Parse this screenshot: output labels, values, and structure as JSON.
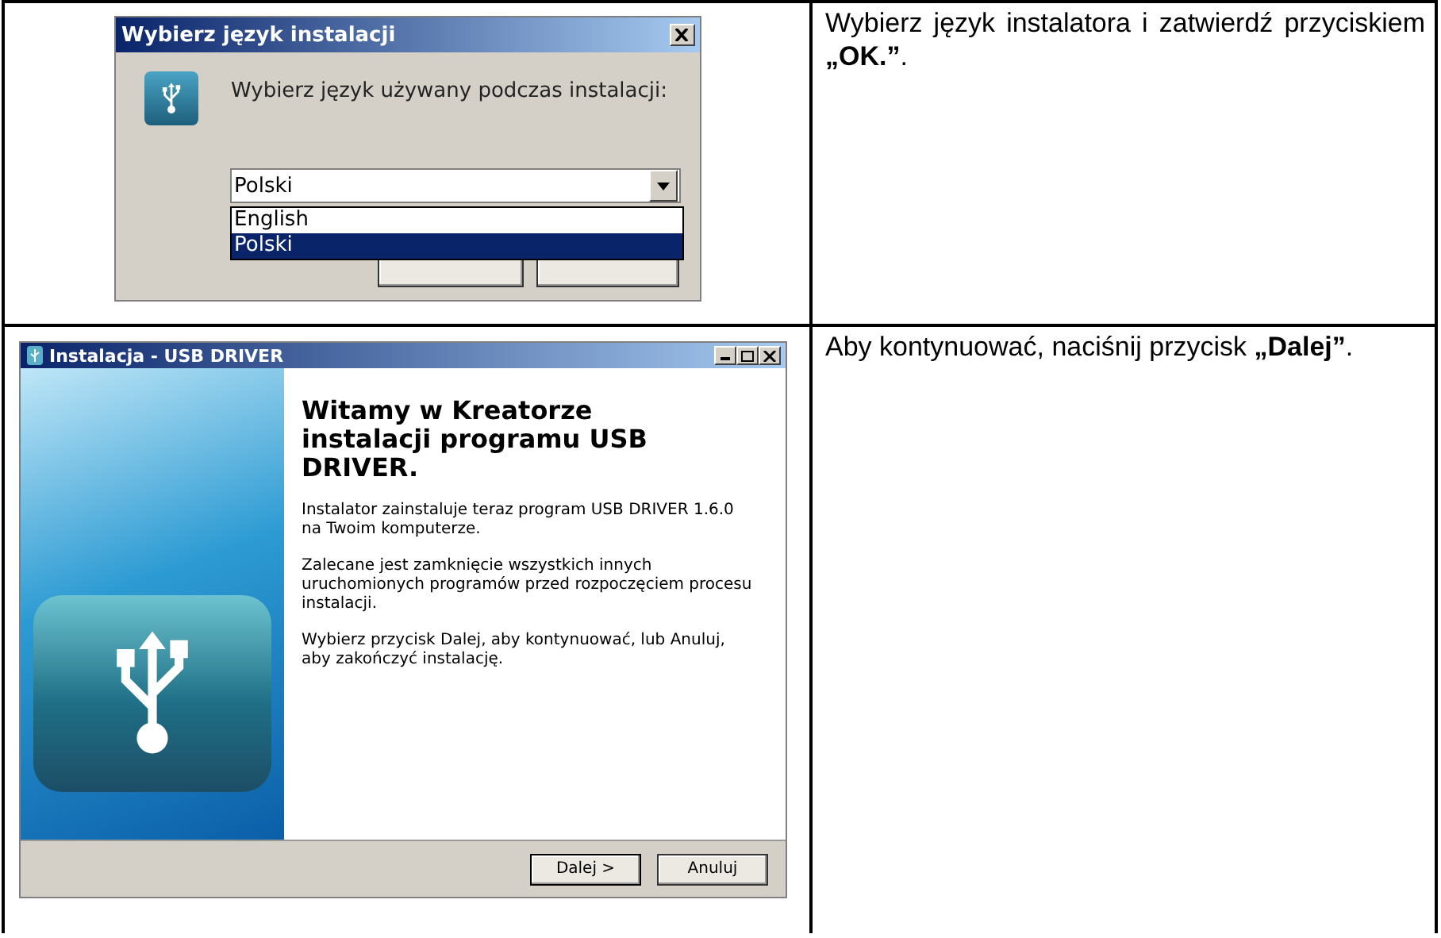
{
  "rows": [
    {
      "dialog": {
        "kind": "language",
        "title": "Wybierz język instalacji",
        "prompt": "Wybierz język używany podczas instalacji:",
        "combo_value": "Polski",
        "options": [
          {
            "label": "English",
            "selected": false
          },
          {
            "label": "Polski",
            "selected": true
          }
        ]
      },
      "instruction": "Wybierz język instalatora i zatwierdź przyciskiem **„OK.”**."
    },
    {
      "dialog": {
        "kind": "wizard",
        "title": "Instalacja - USB DRIVER",
        "heading": "Witamy w Kreatorze instalacji programu USB DRIVER.",
        "paragraphs": [
          "Instalator zainstaluje teraz program USB DRIVER 1.6.0 na Twoim komputerze.",
          "Zalecane jest zamknięcie wszystkich innych uruchomionych programów przed rozpoczęciem procesu instalacji.",
          "Wybierz przycisk Dalej, aby kontynuować, lub Anuluj, aby zakończyć instalację."
        ],
        "buttons": [
          "Dalej >",
          "Anuluj"
        ]
      },
      "instruction": "Aby kontynuować, naciśnij przycisk **„Dalej”**."
    }
  ]
}
